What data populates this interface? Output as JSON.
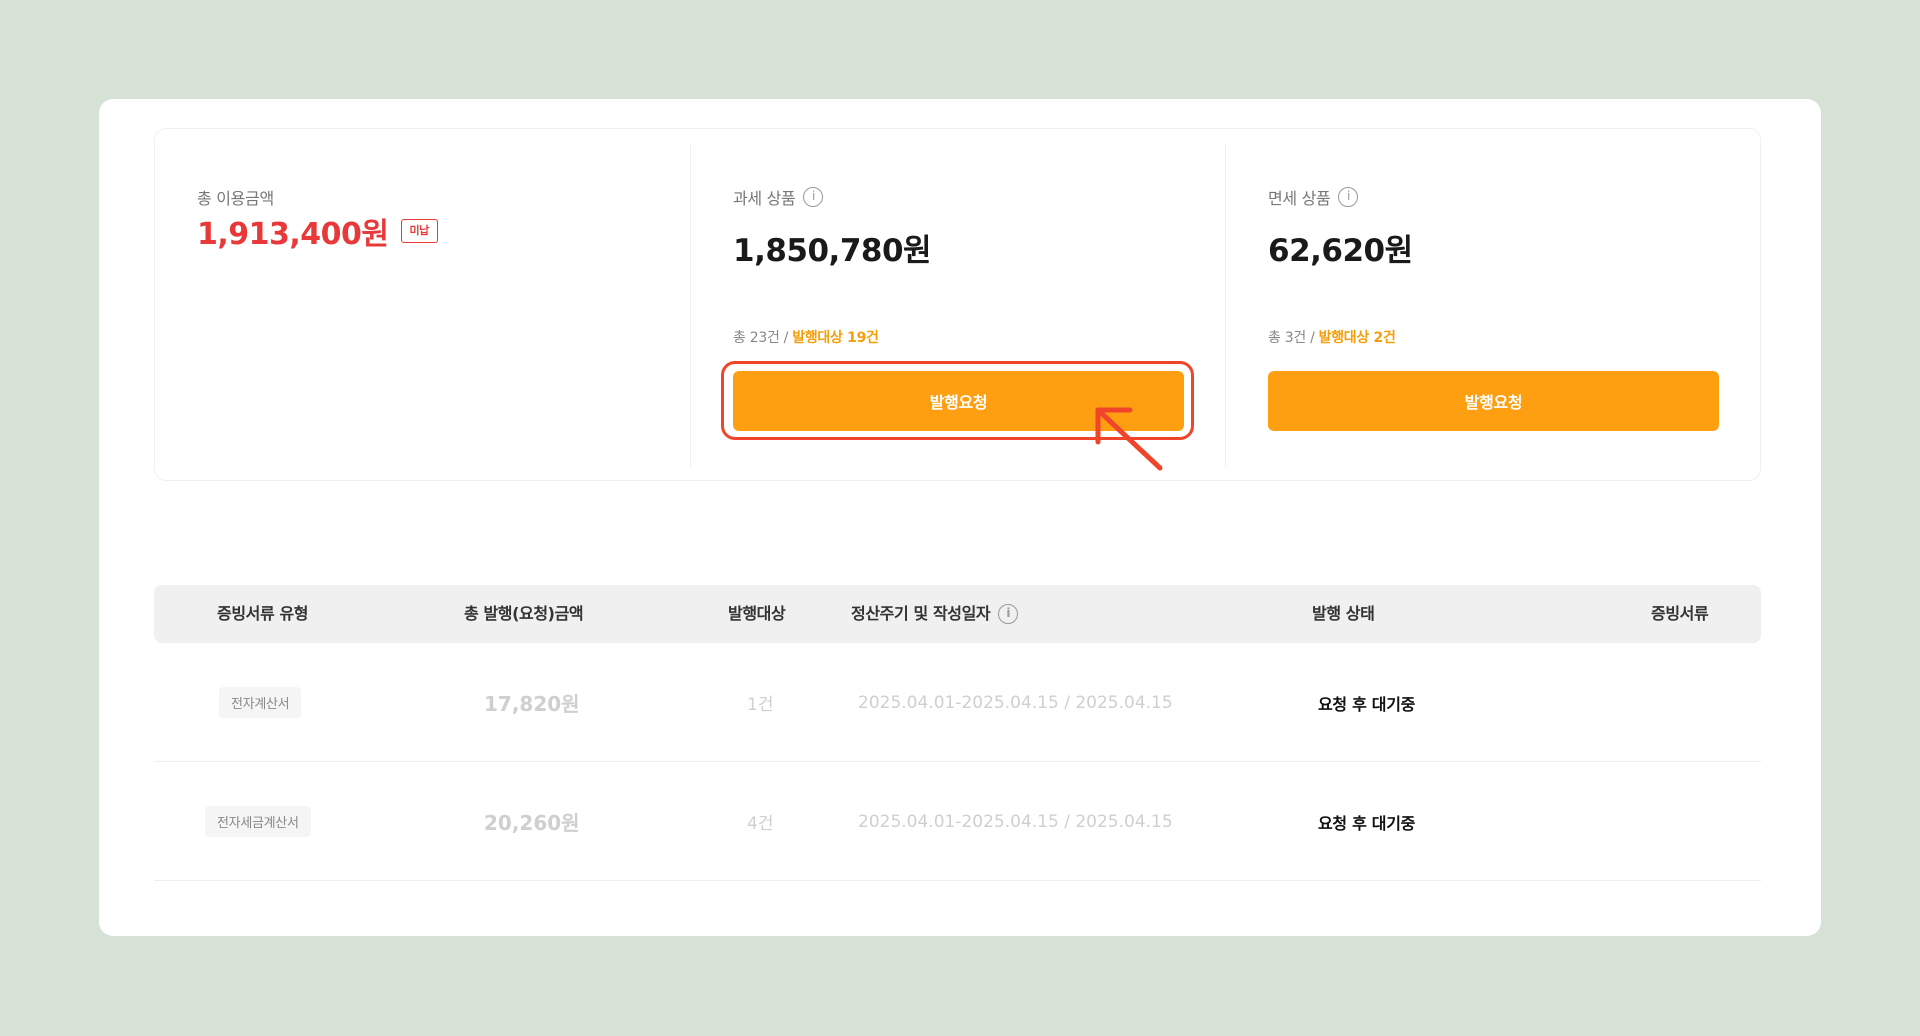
{
  "summary": {
    "total": {
      "label": "총 이용금액",
      "amount": "1,913,400원",
      "badge": "미납"
    },
    "taxable": {
      "label": "과세 상품",
      "amount": "1,850,780원",
      "count_prefix": "총 23건 / ",
      "count_target": "발행대상 19건",
      "button_label": "발행요청"
    },
    "taxfree": {
      "label": "면세 상품",
      "amount": "62,620원",
      "count_prefix": "총 3건 / ",
      "count_target": "발행대상 2건",
      "button_label": "발행요청"
    },
    "info_icon_glyph": "i"
  },
  "table": {
    "headers": [
      "증빙서류 유형",
      "총 발행(요청)금액",
      "발행대상",
      "정산주기 및 작성일자",
      "발행 상태",
      "증빙서류"
    ],
    "rows": [
      {
        "type": "전자계산서",
        "amount": "17,820원",
        "targets": "1건",
        "period": "2025.04.01-2025.04.15 / 2025.04.15",
        "status": "요청 후 대기중",
        "document": ""
      },
      {
        "type": "전자세금계산서",
        "amount": "20,260원",
        "targets": "4건",
        "period": "2025.04.01-2025.04.15 / 2025.04.15",
        "status": "요청 후 대기중",
        "document": ""
      }
    ]
  },
  "colors": {
    "background": "#d6e2d6",
    "accent_orange": "#fd9f11",
    "total_red": "#e8393a",
    "highlight_red": "#f0452b",
    "target_text": "#f59e0b"
  }
}
